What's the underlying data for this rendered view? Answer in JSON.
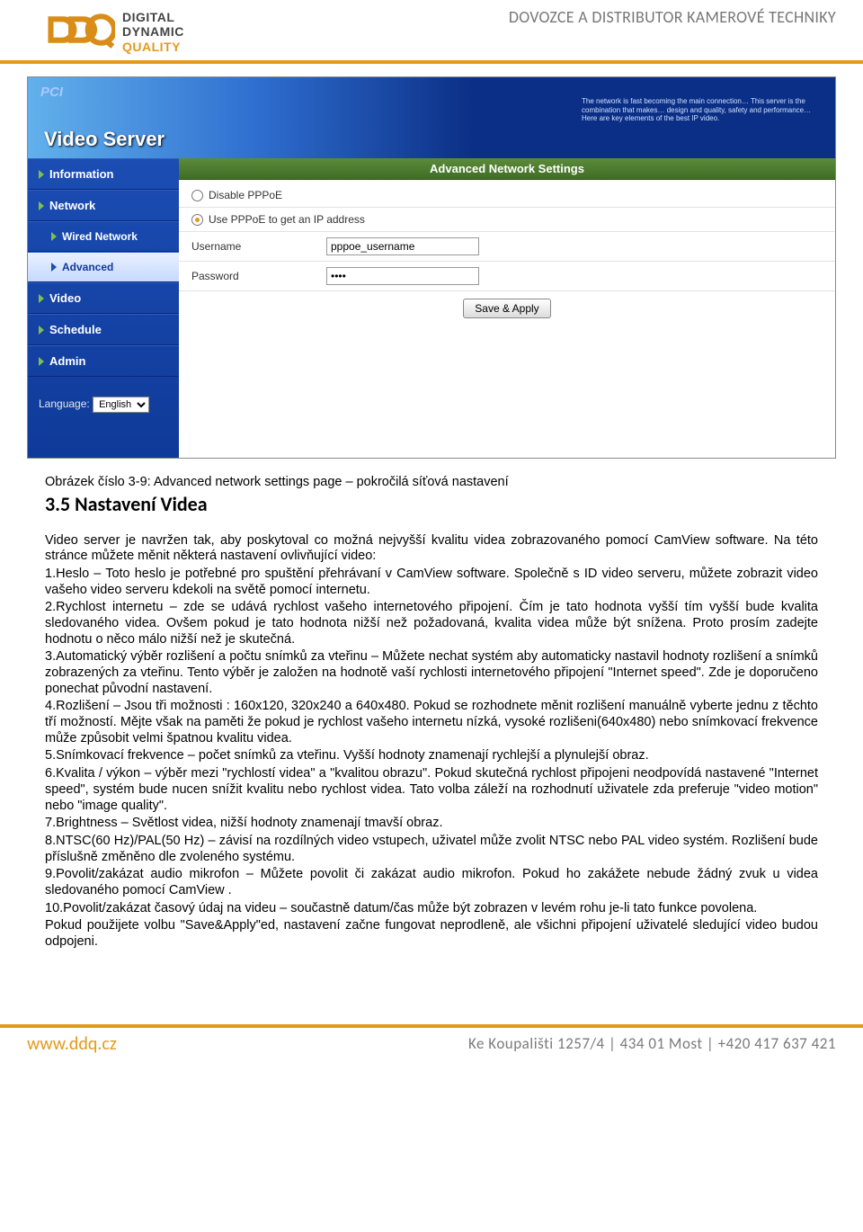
{
  "header": {
    "logo_text": {
      "l1": "DIGITAL",
      "l2": "DYNAMIC",
      "l3": "QUALITY"
    },
    "tagline": "DOVOZCE A DISTRIBUTOR KAMEROVÉ TECHNIKY"
  },
  "screenshot": {
    "banner_logo": "PCI",
    "banner_title": "Video Server",
    "banner_blurb": "The network is fast becoming the main connection… This server is the combination that makes… design and quality, safety and performance… Here are key elements of the best IP video.",
    "section_title": "Advanced Network Settings",
    "sidebar": {
      "items": [
        {
          "label": "Information",
          "sub": false,
          "active": false
        },
        {
          "label": "Network",
          "sub": false,
          "active": false
        },
        {
          "label": "Wired Network",
          "sub": true,
          "active": false
        },
        {
          "label": "Advanced",
          "sub": true,
          "active": true
        },
        {
          "label": "Video",
          "sub": false,
          "active": false
        },
        {
          "label": "Schedule",
          "sub": false,
          "active": false
        },
        {
          "label": "Admin",
          "sub": false,
          "active": false
        }
      ],
      "language_label": "Language:",
      "language_value": "English"
    },
    "form": {
      "opt_disable": "Disable PPPoE",
      "opt_use": "Use PPPoE to get an IP address",
      "username_label": "Username",
      "username_value": "pppoe_username",
      "password_label": "Password",
      "password_value": "••••",
      "save_btn": "Save & Apply"
    }
  },
  "doc": {
    "caption": "Obrázek číslo 3-9: Advanced network settings page – pokročilá síťová nastavení",
    "h2": "3.5 Nastavení Videa",
    "intro": "Video server je navržen tak, aby poskytoval co možná nejvyšší kvalitu videa zobrazovaného pomocí CamView software. Na této stránce můžete měnit některá nastavení ovlivňující video:",
    "p1": "1.Heslo – Toto heslo je potřebné pro spuštění přehrávaní v CamView software. Společně s ID video serveru, můžete zobrazit video vašeho video serveru kdekoli na světě pomocí internetu.",
    "p2": "2.Rychlost internetu – zde se udává rychlost vašeho internetového připojení. Čím je tato hodnota vyšší tím vyšší bude kvalita sledovaného videa. Ovšem pokud je tato hodnota nižší než požadovaná, kvalita videa může být snížena. Proto prosím zadejte hodnotu o něco málo nižší než je skutečná.",
    "p3": "3.Automatický výběr rozlišení a počtu snímků za vteřinu – Můžete nechat systém aby automaticky nastavil hodnoty rozlišení a snímků zobrazených za vteřinu. Tento výběr  je založen na hodnotě vaší rychlosti internetového připojení \"Internet speed\". Zde je doporučeno ponechat původní nastavení.",
    "p4": "4.Rozlišení – Jsou tři možnosti : 160x120, 320x240 a 640x480. Pokud se rozhodnete měnit rozlišení manuálně vyberte jednu z těchto tří možností. Mějte však na paměti že pokud je rychlost vašeho internetu nízká, vysoké rozlišeni(640x480) nebo snímkovací frekvence může způsobit velmi špatnou kvalitu videa.",
    "p5": "5.Snímkovací frekvence – počet snímků za vteřinu. Vyšší hodnoty znamenají rychlejší a plynulejší obraz.",
    "p6": "6.Kvalita / výkon – výběr mezi \"rychlostí videa\" a \"kvalitou obrazu\". Pokud skutečná rychlost připojeni neodpovídá nastavené \"Internet speed\", systém bude nucen snížit kvalitu nebo rychlost videa. Tato volba záleží na rozhodnutí uživatele zda preferuje \"video motion\" nebo \"image quality\".",
    "p7": "7.Brightness – Světlost videa, nižší hodnoty znamenají tmavší obraz.",
    "p8": "8.NTSC(60 Hz)/PAL(50 Hz) – závisí na rozdílných video vstupech, uživatel může zvolit NTSC nebo PAL video systém. Rozlišení bude příslušně změněno dle zvoleného systému.",
    "p9": "9.Povolit/zakázat audio mikrofon – Můžete povolit či zakázat audio mikrofon. Pokud ho zakážete nebude žádný zvuk u videa sledovaného pomocí CamView .",
    "p10": "10.Povolit/zakázat časový údaj na videu – součastně datum/čas může být zobrazen v levém rohu je-li tato funkce povolena.",
    "p11": "Pokud použijete volbu \"Save&Apply\"ed, nastavení začne fungovat neprodleně, ale všichni připojení uživatelé sledující video budou odpojeni."
  },
  "footer": {
    "url": "www.ddq.cz",
    "info": "Ke Koupališti 1257/4  |  434 01 Most  |  +420 417 637 421"
  }
}
